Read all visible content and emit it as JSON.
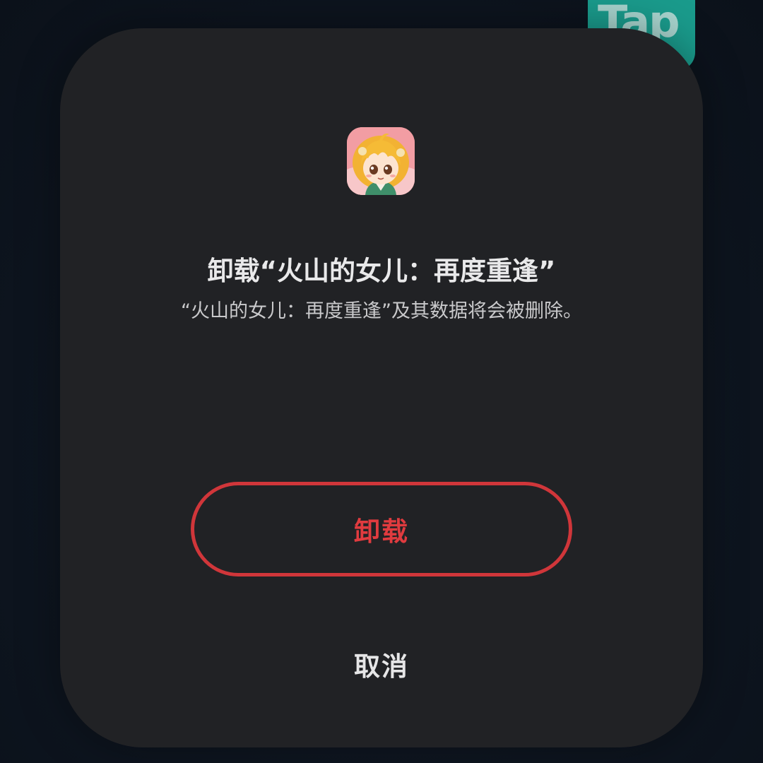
{
  "background": {
    "app_icon_label": "Tap",
    "app_icon_color": "#1a9b8c"
  },
  "dialog": {
    "title": "卸载“火山的女儿：再度重逢”",
    "message": "“火山的女儿：再度重逢”及其数据将会被删除。",
    "app_icon": "game-character-app-icon",
    "uninstall_label": "卸载",
    "cancel_label": "取消",
    "accent_color": "#e03b3f",
    "background_color": "#212225"
  }
}
